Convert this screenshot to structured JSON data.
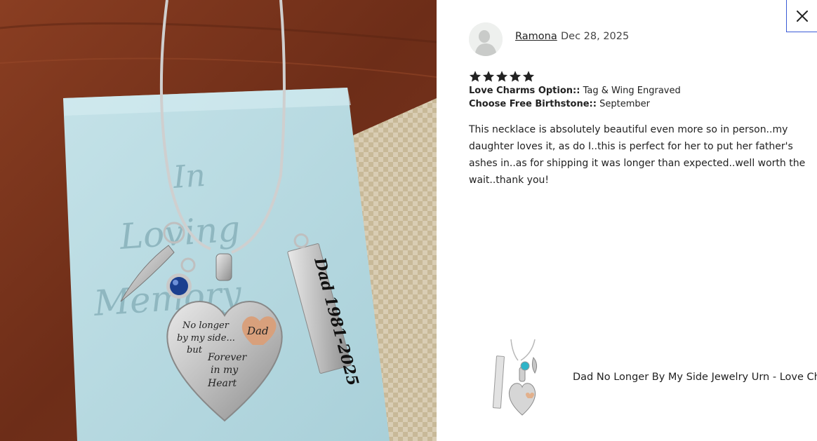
{
  "review": {
    "reviewer_name": "Ramona",
    "date": "Dec 28, 2025",
    "rating": 5,
    "options": [
      {
        "label": "Love Charms Option::",
        "value": "Tag & Wing Engraved"
      },
      {
        "label": "Choose Free Birthstone::",
        "value": "September"
      }
    ],
    "text": "This necklace is absolutely beautiful even more so in person..my daughter loves it, as do I..this is perfect for her to put her father's ashes in..as for shipping it was longer than expected..well worth the wait..thank you!"
  },
  "photo": {
    "box_text": [
      "In",
      "Loving",
      "Memory"
    ],
    "heart_text": [
      "No longer",
      "by my side...",
      "but",
      "Forever",
      "in my",
      "Heart"
    ],
    "heart_tag": "Dad",
    "bar_tag": "Dad 1981-2025"
  },
  "product": {
    "title": "Dad No Longer By My Side Jewelry Urn - Love Char..."
  },
  "icons": {
    "close": "close-icon",
    "star": "star-icon",
    "avatar": "default-avatar-icon"
  },
  "colors": {
    "close_border": "#3b5bd6",
    "star": "#222222",
    "box": "#b9dbe2"
  }
}
